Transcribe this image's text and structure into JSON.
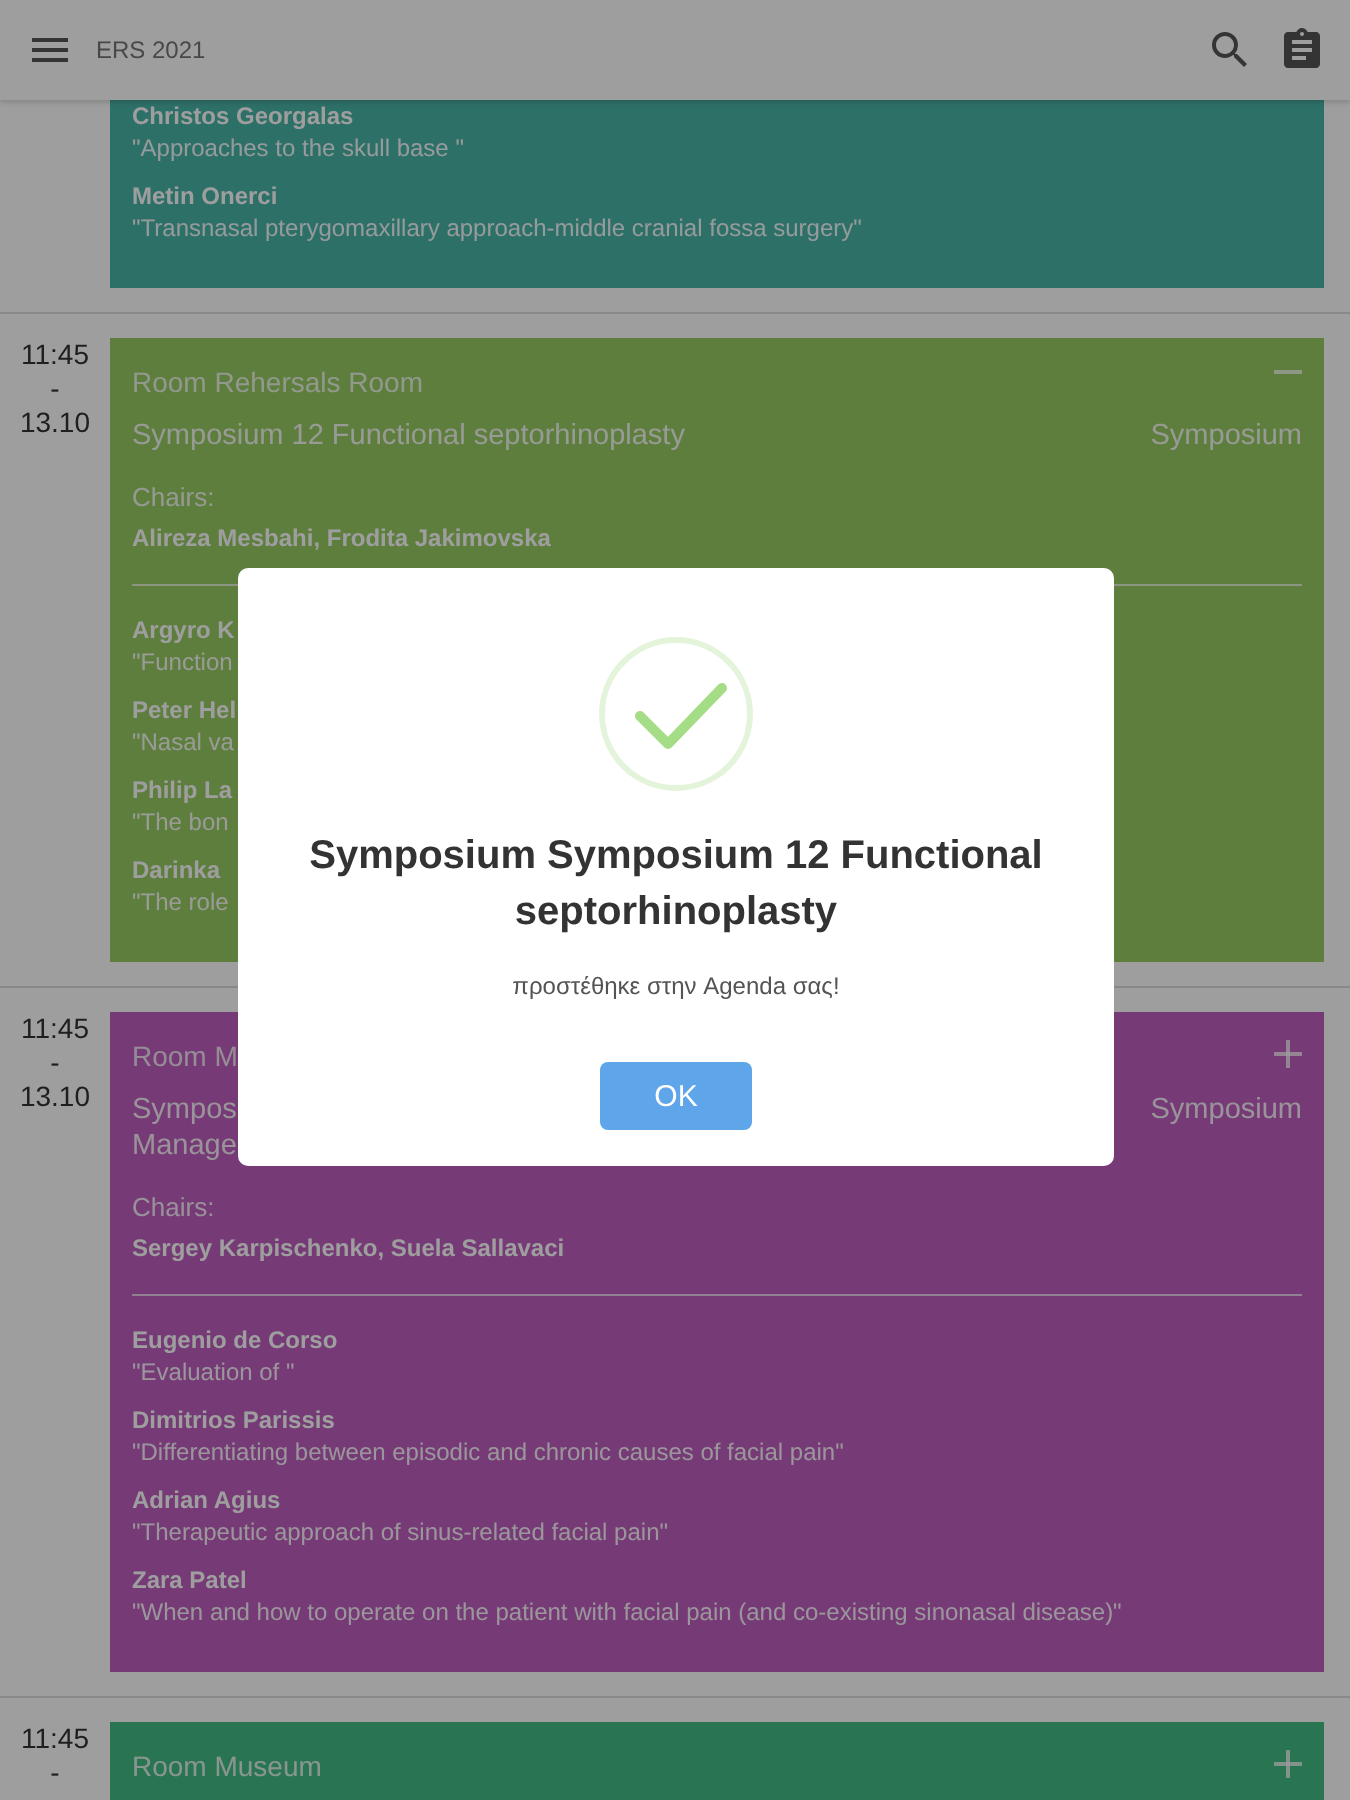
{
  "app_bar": {
    "title": "ERS 2021"
  },
  "sessions": [
    {
      "color": "#2e7068",
      "speakers": [
        {
          "name": "Christos Georgalas",
          "talk": "\"Approaches to the skull base \""
        },
        {
          "name": "Metin Onerci",
          "talk": "\"Transnasal pterygomaxillary approach-middle cranial fossa surgery\""
        }
      ]
    },
    {
      "time": [
        "11:45",
        "-",
        "13.10"
      ],
      "color": "#5e7e3e",
      "room": "Room Rehersals Room",
      "in_agenda": true,
      "title_lines": [
        "Symposium 12 Functional septorhinoplasty"
      ],
      "type": "Symposium",
      "chairs_label": "Chairs:",
      "chairs": "Alireza Mesbahi, Frodita Jakimovska",
      "speakers": [
        {
          "name": "Argyro K",
          "talk": "\"Function"
        },
        {
          "name": "Peter Hel",
          "talk": "\"Nasal va"
        },
        {
          "name": "Philip La",
          "talk": "\"The bon"
        },
        {
          "name": "Darinka",
          "talk": "\"The role"
        }
      ]
    },
    {
      "time": [
        "11:45",
        "-",
        "13.10"
      ],
      "color": "#763a76",
      "room": "Room M",
      "in_agenda": false,
      "title_lines": [
        "Sympos",
        "Manage"
      ],
      "type": "Symposium",
      "chairs_label": "Chairs:",
      "chairs": "Sergey Karpischenko, Suela Sallavaci",
      "speakers": [
        {
          "name": "Eugenio de Corso",
          "talk": "\"Evaluation of \""
        },
        {
          "name": "Dimitrios Parissis",
          "talk": "\"Differentiating between episodic and chronic causes of facial pain\""
        },
        {
          "name": "Adrian Agius",
          "talk": "\"Therapeutic approach of sinus-related facial pain\""
        },
        {
          "name": "Zara Patel",
          "talk": "\"When and how to operate on the patient with facial pain (and co-existing sinonasal disease)\""
        }
      ]
    },
    {
      "time": [
        "11:45",
        "-"
      ],
      "color": "#2a7552",
      "room": "Room Museum",
      "in_agenda": false
    }
  ],
  "dialog": {
    "title": "Symposium Symposium 12 Functional septorhinoplasty",
    "message": "προστέθηκε στην Agenda σας!",
    "button": "OK"
  }
}
